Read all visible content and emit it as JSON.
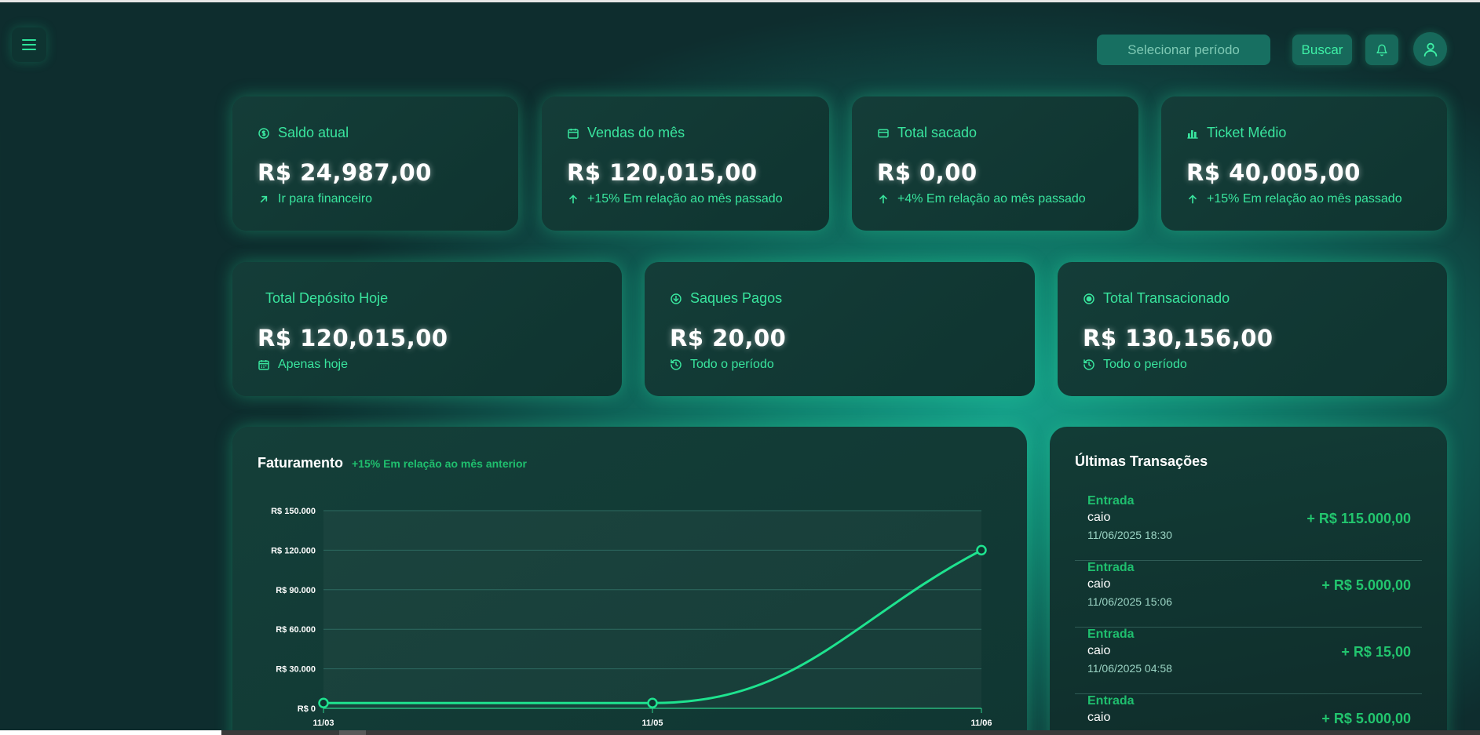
{
  "header": {
    "period_placeholder": "Selecionar período",
    "search_label": "Buscar"
  },
  "stats_row1": [
    {
      "label": "Saldo atual",
      "value": "R$ 24,987,00",
      "sub": "Ir para financeiro",
      "icon": "dollar-circle-icon",
      "sub_icon": "arrow-up-right-icon"
    },
    {
      "label": "Vendas do mês",
      "value": "R$ 120,015,00",
      "sub": "+15% Em relação ao mês passado",
      "icon": "calendar-icon",
      "sub_icon": "arrow-up-icon"
    },
    {
      "label": "Total sacado",
      "value": "R$ 0,00",
      "sub": "+4% Em relação ao mês passado",
      "icon": "credit-card-icon",
      "sub_icon": "arrow-up-icon"
    },
    {
      "label": "Ticket Médio",
      "value": "R$ 40,005,00",
      "sub": "+15% Em relação ao mês passado",
      "icon": "bar-chart-icon",
      "sub_icon": "arrow-up-icon"
    }
  ],
  "stats_row2": [
    {
      "label": "Total Depósito Hoje",
      "value": "R$ 120,015,00",
      "sub": "Apenas hoje",
      "sub_icon": "calendar-icon"
    },
    {
      "label": "Saques Pagos",
      "value": "R$ 20,00",
      "sub": "Todo o período",
      "icon": "arrow-down-circle-icon",
      "sub_icon": "history-icon"
    },
    {
      "label": "Total Transacionado",
      "value": "R$ 130,156,00",
      "sub": "Todo o período",
      "icon": "target-circle-icon",
      "sub_icon": "history-icon"
    }
  ],
  "revenue": {
    "title": "Faturamento",
    "subtitle": "+15% Em relação ao mês anterior"
  },
  "chart_data": {
    "type": "line",
    "title": "Faturamento",
    "x": [
      "11/03",
      "11/05",
      "11/06"
    ],
    "series": [
      {
        "values": [
          4000,
          4000,
          120000
        ]
      }
    ],
    "ylim": [
      0,
      150000
    ],
    "yticks": [
      "R$ 0",
      "R$ 30.000",
      "R$ 60.000",
      "R$ 90.000",
      "R$ 120.000",
      "R$ 150.000"
    ],
    "ytick_values": [
      0,
      30000,
      60000,
      90000,
      120000,
      150000
    ],
    "grid": true,
    "line_color": "#1ee38f"
  },
  "transactions": {
    "title": "Últimas Transações",
    "items": [
      {
        "type": "Entrada",
        "name": "caio",
        "date": "11/06/2025 18:30",
        "amount": "+ R$ 115.000,00"
      },
      {
        "type": "Entrada",
        "name": "caio",
        "date": "11/06/2025 15:06",
        "amount": "+ R$ 5.000,00"
      },
      {
        "type": "Entrada",
        "name": "caio",
        "date": "11/06/2025 04:58",
        "amount": "+ R$ 15,00"
      },
      {
        "type": "Entrada",
        "name": "caio",
        "date": "",
        "amount": "+ R$ 5.000,00"
      }
    ]
  }
}
